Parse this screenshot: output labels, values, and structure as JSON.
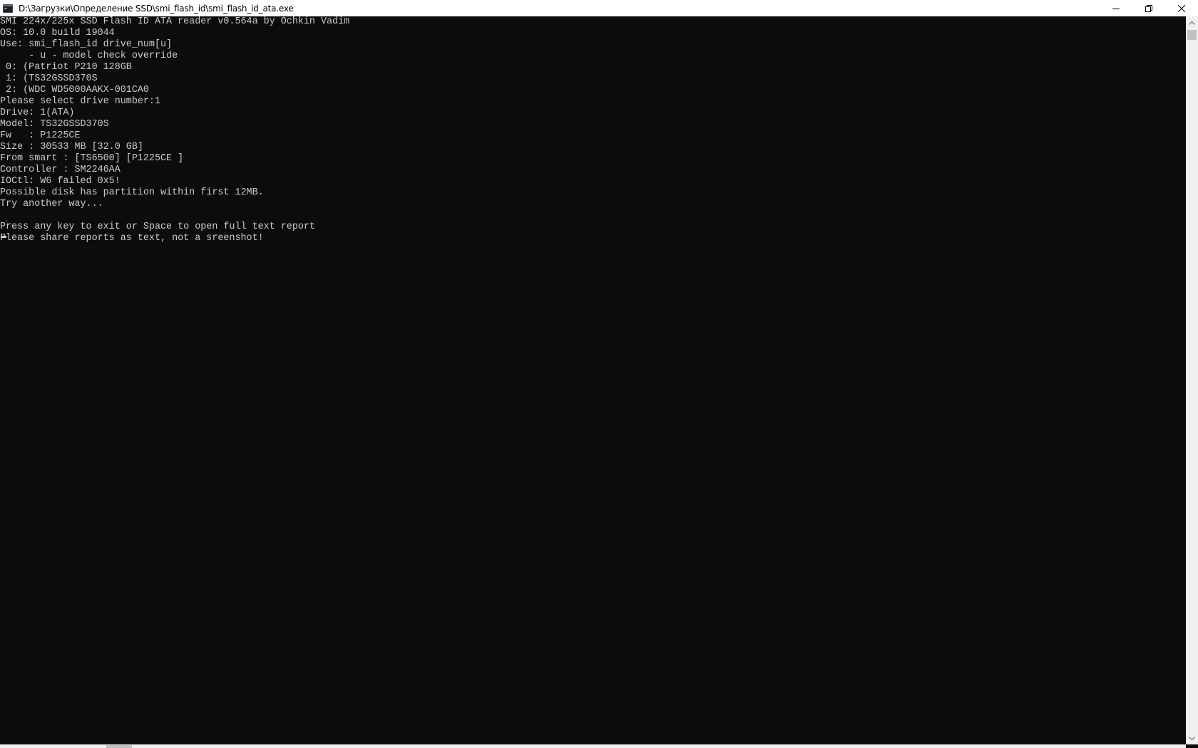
{
  "window": {
    "title": "D:\\Загрузки\\Определение SSD\\smi_flash_id\\smi_flash_id_ata.exe",
    "icon": "console-app-icon",
    "controls": [
      "minimize-icon",
      "restore-icon",
      "close-icon"
    ]
  },
  "console": {
    "lines": [
      "SMI 224x/225x SSD Flash ID ATA reader v0.564a by Ochkin Vadim",
      "OS: 10.0 build 19044",
      "Use: smi_flash_id drive_num[u]",
      "     - u - model check override",
      " 0: (Patriot P210 128GB",
      " 1: (TS32GSSD370S",
      " 2: (WDC WD5000AAKX-001CA0",
      "Please select drive number:1",
      "Drive: 1(ATA)",
      "Model: TS32GSSD370S",
      "Fw   : P1225CE",
      "Size : 30533 MB [32.0 GB]",
      "From smart : [TS6500] [P1225CE ]",
      "Controller : SM2246AA",
      "IOCtl: W6 failed 0x5!",
      "Possible disk has partition within first 12MB.",
      "Try another way...",
      "",
      "Press any key to exit or Space to open full text report",
      "Please share reports as text, not a sreenshot!"
    ]
  },
  "colors": {
    "background": "#0c0c0c",
    "text": "#cccccc",
    "titlebar": "#ffffff"
  }
}
